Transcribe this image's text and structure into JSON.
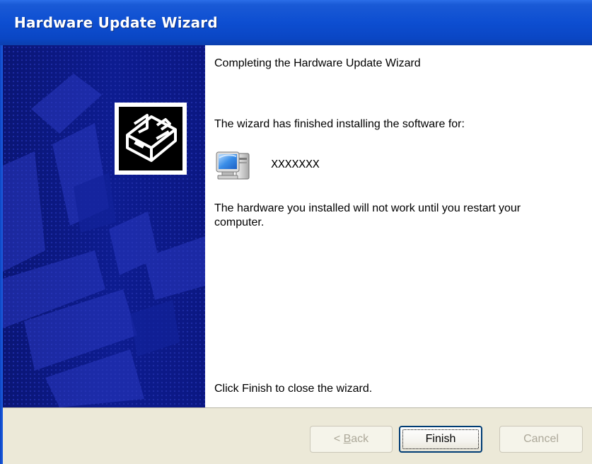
{
  "window": {
    "title": "Hardware Update Wizard"
  },
  "content": {
    "heading": "Completing the Hardware Update Wizard",
    "finished_message": "The wizard has finished installing the software for:",
    "device_icon": "computer-monitor-icon",
    "device_name": "XXXXXXX",
    "restart_message": "The hardware you installed will not work until you restart your computer.",
    "close_instruction": "Click Finish to close the wizard."
  },
  "buttons": {
    "back": {
      "prefix": "< ",
      "accel": "B",
      "rest": "ack",
      "enabled": false
    },
    "finish": {
      "label": "Finish",
      "enabled": true,
      "default": true
    },
    "cancel": {
      "label": "Cancel",
      "enabled": false
    }
  },
  "sidebar": {
    "icon": "hardware-box-icon"
  },
  "colors": {
    "titlebar": "#0d4ed1",
    "sidebar": "#0c1a8a",
    "button_bar": "#ece9d8",
    "disabled_text": "#aca899"
  }
}
